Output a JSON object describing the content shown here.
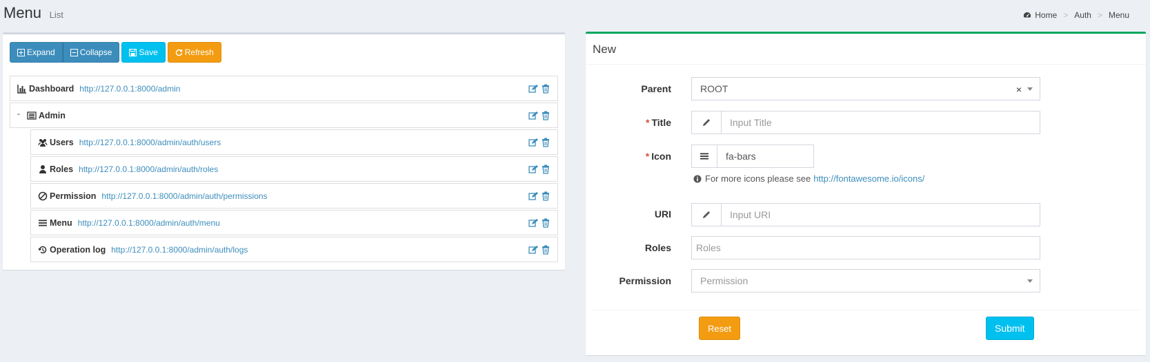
{
  "header": {
    "title": "Menu",
    "subtitle": "List",
    "breadcrumb": [
      "Home",
      "Auth",
      "Menu"
    ],
    "separator": ">"
  },
  "toolbar": {
    "expand_label": "Expand",
    "collapse_label": "Collapse",
    "save_label": "Save",
    "refresh_label": "Refresh"
  },
  "tree": {
    "toggle": "-",
    "items": [
      {
        "title": "Dashboard",
        "uri": "http://127.0.0.1:8000/admin",
        "icon": "bar-chart-icon"
      },
      {
        "title": "Admin",
        "uri": "",
        "icon": "tasks-icon"
      },
      {
        "title": "Users",
        "uri": "http://127.0.0.1:8000/admin/auth/users",
        "icon": "users-icon"
      },
      {
        "title": "Roles",
        "uri": "http://127.0.0.1:8000/admin/auth/roles",
        "icon": "user-icon"
      },
      {
        "title": "Permission",
        "uri": "http://127.0.0.1:8000/admin/auth/permissions",
        "icon": "ban-icon"
      },
      {
        "title": "Menu",
        "uri": "http://127.0.0.1:8000/admin/auth/menu",
        "icon": "bars-icon"
      },
      {
        "title": "Operation log",
        "uri": "http://127.0.0.1:8000/admin/auth/logs",
        "icon": "history-icon"
      }
    ]
  },
  "form": {
    "box_title": "New",
    "required_mark": "*",
    "parent": {
      "label": "Parent",
      "value": "ROOT",
      "clear": "×"
    },
    "title": {
      "label": "Title",
      "placeholder": "Input Title"
    },
    "icon": {
      "label": "Icon",
      "value": "fa-bars"
    },
    "help_text": "For more icons please see",
    "help_link": "http://fontawesome.io/icons/",
    "uri": {
      "label": "URI",
      "placeholder": "Input URI"
    },
    "roles": {
      "label": "Roles",
      "placeholder": "Roles"
    },
    "permission": {
      "label": "Permission",
      "placeholder": "Permission"
    },
    "reset_label": "Reset",
    "submit_label": "Submit"
  },
  "colors": {
    "primary": "#3c8dbc",
    "info": "#00c0ef",
    "warning": "#f39c12",
    "success": "#00a65a",
    "required": "#dd4b39"
  }
}
